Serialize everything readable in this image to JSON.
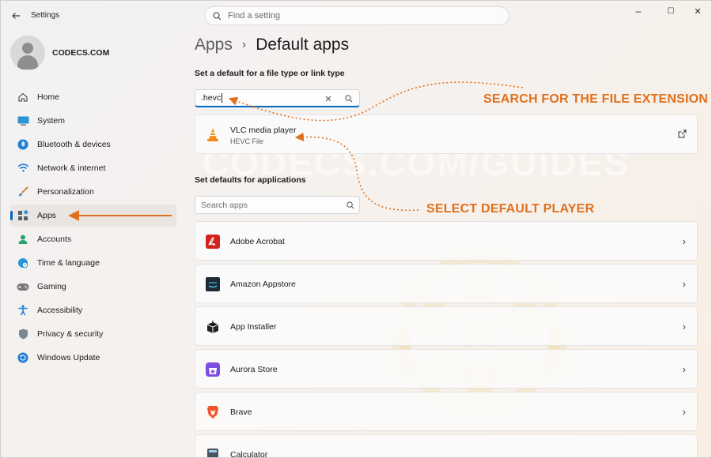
{
  "titlebar": {
    "title": "Settings",
    "search_placeholder": "Find a setting",
    "minimize": "–",
    "maximize": "☐",
    "close": "✕"
  },
  "profile": {
    "name": "CODECS.COM"
  },
  "sidebar": {
    "items": [
      {
        "label": "Home",
        "icon": "home-icon"
      },
      {
        "label": "System",
        "icon": "system-icon"
      },
      {
        "label": "Bluetooth & devices",
        "icon": "bluetooth-icon"
      },
      {
        "label": "Network & internet",
        "icon": "wifi-icon"
      },
      {
        "label": "Personalization",
        "icon": "brush-icon"
      },
      {
        "label": "Apps",
        "icon": "apps-icon",
        "active": true
      },
      {
        "label": "Accounts",
        "icon": "accounts-icon"
      },
      {
        "label": "Time & language",
        "icon": "globe-clock-icon"
      },
      {
        "label": "Gaming",
        "icon": "gamepad-icon"
      },
      {
        "label": "Accessibility",
        "icon": "accessibility-icon"
      },
      {
        "label": "Privacy & security",
        "icon": "shield-icon"
      },
      {
        "label": "Windows Update",
        "icon": "update-icon"
      }
    ]
  },
  "breadcrumb": {
    "parent": "Apps",
    "separator": "›",
    "current": "Default apps"
  },
  "filetype": {
    "label": "Set a default for a file type or link type",
    "value": ".hevc",
    "clear": "✕",
    "result": {
      "app": "VLC media player",
      "sub": "HEVC File"
    }
  },
  "applications": {
    "label": "Set defaults for applications",
    "search_placeholder": "Search apps",
    "list": [
      {
        "name": "Adobe Acrobat",
        "icon": "adobe-acrobat-icon"
      },
      {
        "name": "Amazon Appstore",
        "icon": "amazon-appstore-icon"
      },
      {
        "name": "App Installer",
        "icon": "app-installer-icon"
      },
      {
        "name": "Aurora Store",
        "icon": "aurora-store-icon"
      },
      {
        "name": "Brave",
        "icon": "brave-icon"
      },
      {
        "name": "Calculator",
        "icon": "calculator-icon"
      }
    ]
  },
  "annotations": {
    "search": "SEARCH FOR THE FILE EXTENSION",
    "select": "SELECT DEFAULT PLAYER",
    "color": "#e0701c"
  },
  "watermark": "CODECS.COM/GUIDES",
  "colors": {
    "accent": "#0067c0"
  }
}
